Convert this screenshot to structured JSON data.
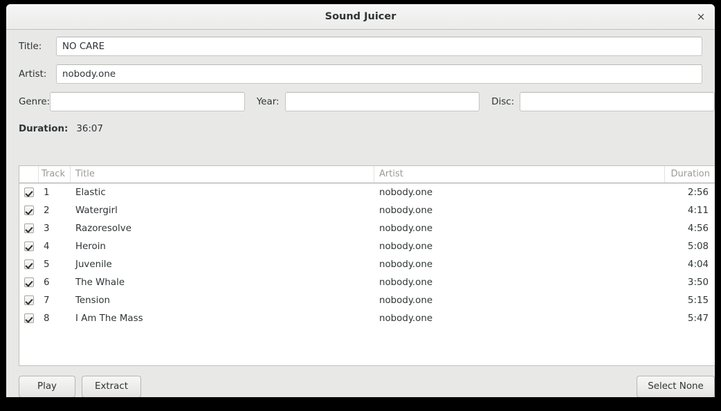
{
  "window": {
    "title": "Sound Juicer",
    "close_icon": "close-icon",
    "close_glyph": "×"
  },
  "form": {
    "title_label": "Title:",
    "title_value": "NO CARE",
    "title_placeholder": "",
    "artist_label": "Artist:",
    "artist_value": "nobody.one",
    "artist_placeholder": "",
    "genre_label": "Genre:",
    "genre_value": "",
    "genre_placeholder": "",
    "year_label": "Year:",
    "year_value": "",
    "year_placeholder": "",
    "disc_label": "Disc:",
    "disc_value": "",
    "disc_placeholder": "",
    "duration_label": "Duration:",
    "duration_value": "36:07"
  },
  "tracklist": {
    "columns": [
      "",
      "Track",
      "Title",
      "Artist",
      "Duration"
    ],
    "rows": [
      {
        "checked": true,
        "track": "1",
        "title": "Elastic",
        "artist": "nobody.one",
        "duration": "2:56"
      },
      {
        "checked": true,
        "track": "2",
        "title": "Watergirl",
        "artist": "nobody.one",
        "duration": "4:11"
      },
      {
        "checked": true,
        "track": "3",
        "title": "Razoresolve",
        "artist": "nobody.one",
        "duration": "4:56"
      },
      {
        "checked": true,
        "track": "4",
        "title": "Heroin",
        "artist": "nobody.one",
        "duration": "5:08"
      },
      {
        "checked": true,
        "track": "5",
        "title": "Juvenile",
        "artist": "nobody.one",
        "duration": "4:04"
      },
      {
        "checked": true,
        "track": "6",
        "title": "The Whale",
        "artist": "nobody.one",
        "duration": "3:50"
      },
      {
        "checked": true,
        "track": "7",
        "title": "Tension",
        "artist": "nobody.one",
        "duration": "5:15"
      },
      {
        "checked": true,
        "track": "8",
        "title": "I Am The Mass",
        "artist": "nobody.one",
        "duration": "5:47"
      }
    ]
  },
  "buttons": {
    "play": "Play",
    "extract": "Extract",
    "select_none": "Select None"
  },
  "colors": {
    "window_bg": "#e8e8e7",
    "titlebar_bg": "#f0f0ef",
    "field_bg": "#ffffff",
    "text": "#2e3436",
    "header_text": "#9a9a97",
    "border": "#bfbfbc"
  }
}
